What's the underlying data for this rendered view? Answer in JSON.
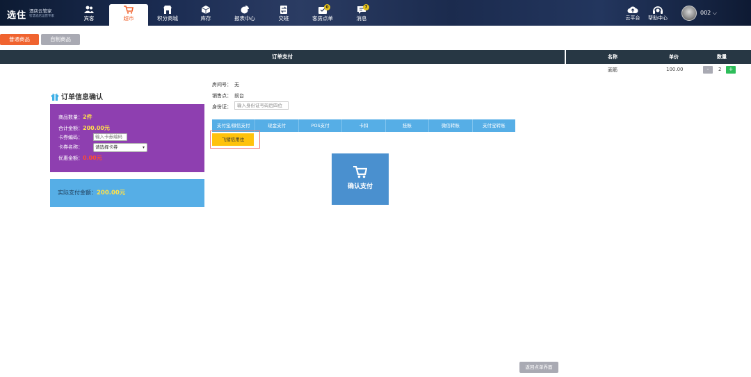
{
  "colors": {
    "accent": "#f0632f",
    "nav_bg": "#1b2c52",
    "header_bar": "#273744",
    "purple": "#8e3fb0",
    "blue": "#56aee6",
    "yellow": "#ffc20d",
    "confirm": "#4a90cf"
  },
  "logo": {
    "main": "选住",
    "title": "酒店云管家",
    "subtitle": "智慧酒店运营专家"
  },
  "nav": [
    {
      "label": "宾客",
      "icon": "guests-icon"
    },
    {
      "label": "超市",
      "icon": "cart-icon"
    },
    {
      "label": "积分商城",
      "icon": "store-icon"
    },
    {
      "label": "库存",
      "icon": "box-icon"
    },
    {
      "label": "报表中心",
      "icon": "pie-chart-icon"
    },
    {
      "label": "交班",
      "icon": "handover-icon"
    },
    {
      "label": "客房点单",
      "icon": "room-order-icon",
      "badge": "0"
    },
    {
      "label": "消息",
      "icon": "message-icon",
      "badge": "7"
    }
  ],
  "right_nav": {
    "cloud": "云平台",
    "help": "帮助中心",
    "user": "002"
  },
  "tabs": {
    "normal": "普通商品",
    "custom": "自制商品"
  },
  "header": {
    "title": "订单支付"
  },
  "cart": {
    "columns": [
      "名称",
      "单价",
      "数量"
    ],
    "item": {
      "name": "面筋",
      "price": "100.00",
      "qty": "2",
      "minus": "-",
      "plus": "+"
    }
  },
  "order": {
    "title": "订单信息确认",
    "count_label": "商品数量：",
    "count": "2件",
    "total_label": "合计金额：",
    "total": "200.00元",
    "card_code_label": "卡券编码：",
    "card_code_placeholder": "输入卡券编码",
    "card_name_label": "卡券名称：",
    "card_name_select": "请选择卡券",
    "discount_label": "优惠金额：",
    "discount": "0.00元",
    "actual_label": "实际支付金额：",
    "actual": "200.00元"
  },
  "info": {
    "room_label": "房间号：",
    "room": "无",
    "sale_label": "销售点：",
    "sale": "前台",
    "id_label": "身份证：",
    "id_placeholder": "输入身份证号码后四位"
  },
  "pay_methods": [
    "支付宝/微信支付",
    "现金支付",
    "POS支付",
    "卡扣",
    "挂账",
    "微信转账",
    "支付宝转账"
  ],
  "feizhu": "飞猪信用住",
  "confirm": "确认支付",
  "back": "返回点单界面"
}
